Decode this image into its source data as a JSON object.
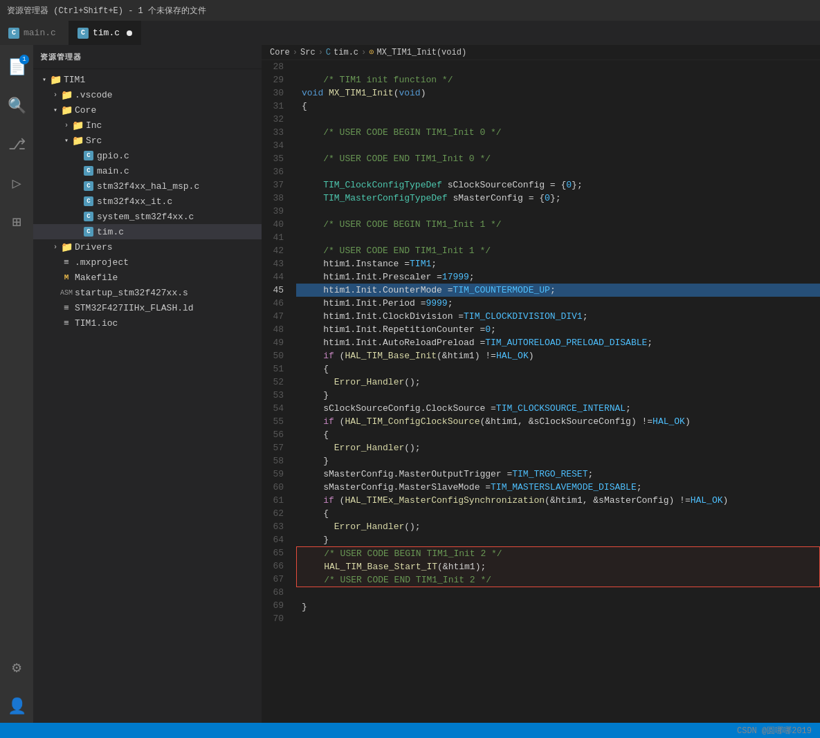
{
  "titleBar": {
    "text": "资源管理器 (Ctrl+Shift+E) - 1 个未保存的文件"
  },
  "tabs": [
    {
      "label": "main.c",
      "active": false,
      "unsaved": false
    },
    {
      "label": "tim.c",
      "active": true,
      "unsaved": true
    }
  ],
  "breadcrumb": {
    "parts": [
      "Core",
      "Src",
      "tim.c",
      "MX_TIM1_Init(void)"
    ]
  },
  "sidebar": {
    "title": "资源管理器",
    "tree": [
      {
        "level": 1,
        "type": "folder",
        "open": true,
        "label": "TIM1"
      },
      {
        "level": 2,
        "type": "folder",
        "open": false,
        "label": ".vscode"
      },
      {
        "level": 2,
        "type": "folder",
        "open": true,
        "label": "Core"
      },
      {
        "level": 3,
        "type": "folder",
        "open": false,
        "label": "Inc"
      },
      {
        "level": 3,
        "type": "folder",
        "open": true,
        "label": "Src"
      },
      {
        "level": 4,
        "type": "c",
        "label": "gpio.c"
      },
      {
        "level": 4,
        "type": "c",
        "label": "main.c"
      },
      {
        "level": 4,
        "type": "c",
        "label": "stm32f4xx_hal_msp.c"
      },
      {
        "level": 4,
        "type": "c",
        "label": "stm32f4xx_it.c"
      },
      {
        "level": 4,
        "type": "c",
        "label": "system_stm32f4xx.c"
      },
      {
        "level": 4,
        "type": "c",
        "label": "tim.c",
        "selected": true
      },
      {
        "level": 2,
        "type": "folder",
        "open": false,
        "label": "Drivers"
      },
      {
        "level": 2,
        "type": "text",
        "label": ".mxproject"
      },
      {
        "level": 2,
        "type": "make",
        "label": "Makefile"
      },
      {
        "level": 2,
        "type": "asm",
        "label": "startup_stm32f427xx.s"
      },
      {
        "level": 2,
        "type": "text",
        "label": "STM32F427IIHx_FLASH.ld"
      },
      {
        "level": 2,
        "type": "ioc",
        "label": "TIM1.ioc"
      }
    ]
  },
  "code": {
    "lines": [
      {
        "num": 28,
        "content": ""
      },
      {
        "num": 29,
        "content": "    /* TIM1 init function */",
        "type": "comment"
      },
      {
        "num": 30,
        "content": "void MX_TIM1_Init(void)",
        "type": "code"
      },
      {
        "num": 31,
        "content": "{",
        "type": "code"
      },
      {
        "num": 32,
        "content": ""
      },
      {
        "num": 33,
        "content": "    /* USER CODE BEGIN TIM1_Init 0 */",
        "type": "comment"
      },
      {
        "num": 34,
        "content": ""
      },
      {
        "num": 35,
        "content": "    /* USER CODE END TIM1_Init 0 */",
        "type": "comment"
      },
      {
        "num": 36,
        "content": ""
      },
      {
        "num": 37,
        "content": "    TIM_ClockConfigTypeDef sClockSourceConfig = {0};",
        "type": "code"
      },
      {
        "num": 38,
        "content": "    TIM_MasterConfigTypeDef sMasterConfig = {0};",
        "type": "code"
      },
      {
        "num": 39,
        "content": ""
      },
      {
        "num": 40,
        "content": "    /* USER CODE BEGIN TIM1_Init 1 */",
        "type": "comment"
      },
      {
        "num": 41,
        "content": ""
      },
      {
        "num": 42,
        "content": "    /* USER CODE END TIM1_Init 1 */",
        "type": "comment"
      },
      {
        "num": 43,
        "content": "    htim1.Instance = TIM1;",
        "type": "code"
      },
      {
        "num": 44,
        "content": "    htim1.Init.Prescaler = 17999;",
        "type": "code"
      },
      {
        "num": 45,
        "content": "    htim1.Init.CounterMode = TIM_COUNTERMODE_UP;",
        "type": "code",
        "highlighted": true
      },
      {
        "num": 46,
        "content": "    htim1.Init.Period = 9999;",
        "type": "code"
      },
      {
        "num": 47,
        "content": "    htim1.Init.ClockDivision = TIM_CLOCKDIVISION_DIV1;",
        "type": "code"
      },
      {
        "num": 48,
        "content": "    htim1.Init.RepetitionCounter = 0;",
        "type": "code"
      },
      {
        "num": 49,
        "content": "    htim1.Init.AutoReloadPreload = TIM_AUTORELOAD_PRELOAD_DISABLE;",
        "type": "code"
      },
      {
        "num": 50,
        "content": "    if (HAL_TIM_Base_Init(&htim1) != HAL_OK)",
        "type": "code"
      },
      {
        "num": 51,
        "content": "    {",
        "type": "code"
      },
      {
        "num": 52,
        "content": "      Error_Handler();",
        "type": "code"
      },
      {
        "num": 53,
        "content": "    }",
        "type": "code"
      },
      {
        "num": 54,
        "content": "    sClockSourceConfig.ClockSource = TIM_CLOCKSOURCE_INTERNAL;",
        "type": "code"
      },
      {
        "num": 55,
        "content": "    if (HAL_TIM_ConfigClockSource(&htim1, &sClockSourceConfig) != HAL_OK)",
        "type": "code"
      },
      {
        "num": 56,
        "content": "    {",
        "type": "code"
      },
      {
        "num": 57,
        "content": "      Error_Handler();",
        "type": "code"
      },
      {
        "num": 58,
        "content": "    }",
        "type": "code"
      },
      {
        "num": 59,
        "content": "    sMasterConfig.MasterOutputTrigger = TIM_TRGO_RESET;",
        "type": "code"
      },
      {
        "num": 60,
        "content": "    sMasterConfig.MasterSlaveMode = TIM_MASTERSLAVEMODE_DISABLE;",
        "type": "code"
      },
      {
        "num": 61,
        "content": "    if (HAL_TIMEx_MasterConfigSynchronization(&htim1, &sMasterConfig) != HAL_OK)",
        "type": "code"
      },
      {
        "num": 62,
        "content": "    {",
        "type": "code"
      },
      {
        "num": 63,
        "content": "      Error_Handler();",
        "type": "code"
      },
      {
        "num": 64,
        "content": "    }",
        "type": "code"
      },
      {
        "num": 65,
        "content": "    /* USER CODE BEGIN TIM1_Init 2 */",
        "type": "comment",
        "outlined": true
      },
      {
        "num": 66,
        "content": "    HAL_TIM_Base_Start_IT(&htim1);",
        "type": "code",
        "outlined": true
      },
      {
        "num": 67,
        "content": "    /* USER CODE END TIM1_Init 2 */",
        "type": "comment",
        "outlined": true
      },
      {
        "num": 68,
        "content": ""
      },
      {
        "num": 69,
        "content": "}",
        "type": "code"
      },
      {
        "num": 70,
        "content": ""
      }
    ]
  },
  "statusBar": {
    "watermark": "CSDN @圆哪哪2019"
  }
}
